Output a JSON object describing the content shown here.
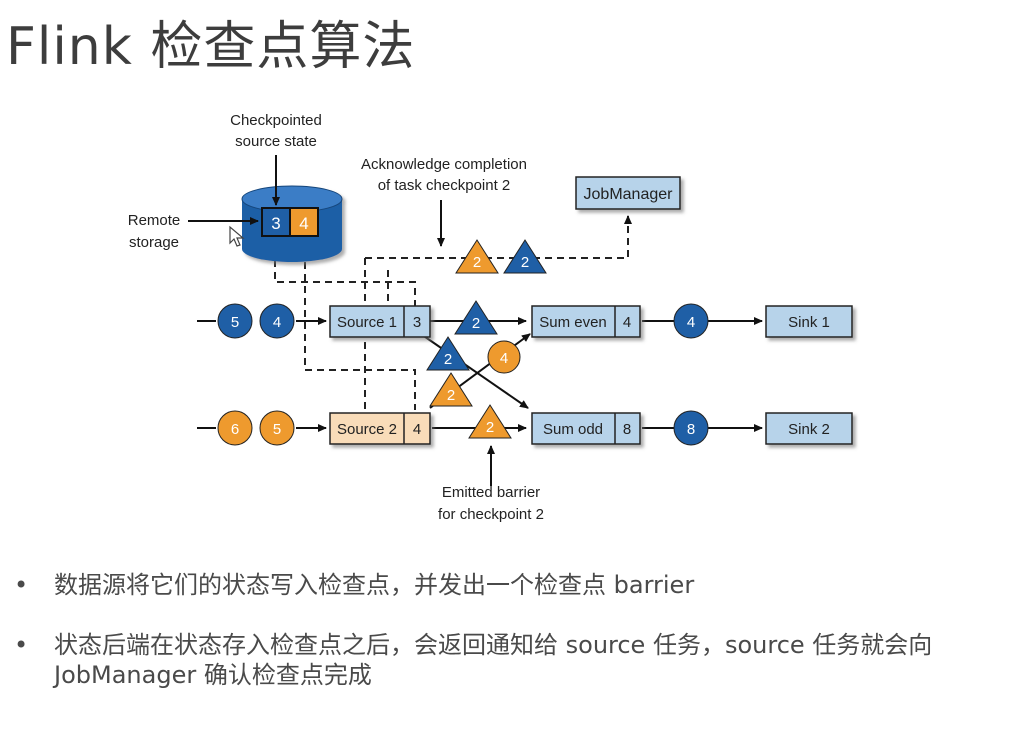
{
  "title": "Flink 检查点算法",
  "labels": {
    "checkpointed_line1": "Checkpointed",
    "checkpointed_line2": "source state",
    "remote_line1": "Remote",
    "remote_line2": "storage",
    "ack_line1": "Acknowledge completion",
    "ack_line2": "of task checkpoint 2",
    "emitted_line1": "Emitted barrier",
    "emitted_line2": "for checkpoint 2"
  },
  "storage_values": [
    "3",
    "4"
  ],
  "tasks": {
    "jobmanager": "JobManager",
    "source1": {
      "name": "Source 1",
      "state": "3"
    },
    "source2": {
      "name": "Source 2",
      "state": "4"
    },
    "sum_even": {
      "name": "Sum even",
      "state": "4"
    },
    "sum_odd": {
      "name": "Sum odd",
      "state": "8"
    },
    "sink1": "Sink 1",
    "sink2": "Sink 2"
  },
  "records": {
    "input1": [
      "5",
      "4"
    ],
    "input2": [
      "6",
      "5"
    ],
    "even_out": "4",
    "odd_out": "8",
    "cross_record": "4"
  },
  "barriers": {
    "ack_orange": "2",
    "ack_blue": "2",
    "source1_out": "2",
    "cross_blue": "2",
    "cross_orange": "2",
    "source2_out": "2"
  },
  "colors": {
    "blue": "#1f5fa6",
    "orange": "#ee9a2e",
    "box_blue": "#b7d3ea",
    "box_orange": "#f9dcb9"
  },
  "bullets": [
    "数据源将它们的状态写入检查点，并发出一个检查点 barrier",
    "状态后端在状态存入检查点之后，会返回通知给 source 任务，source 任务就会向 JobManager 确认检查点完成"
  ]
}
